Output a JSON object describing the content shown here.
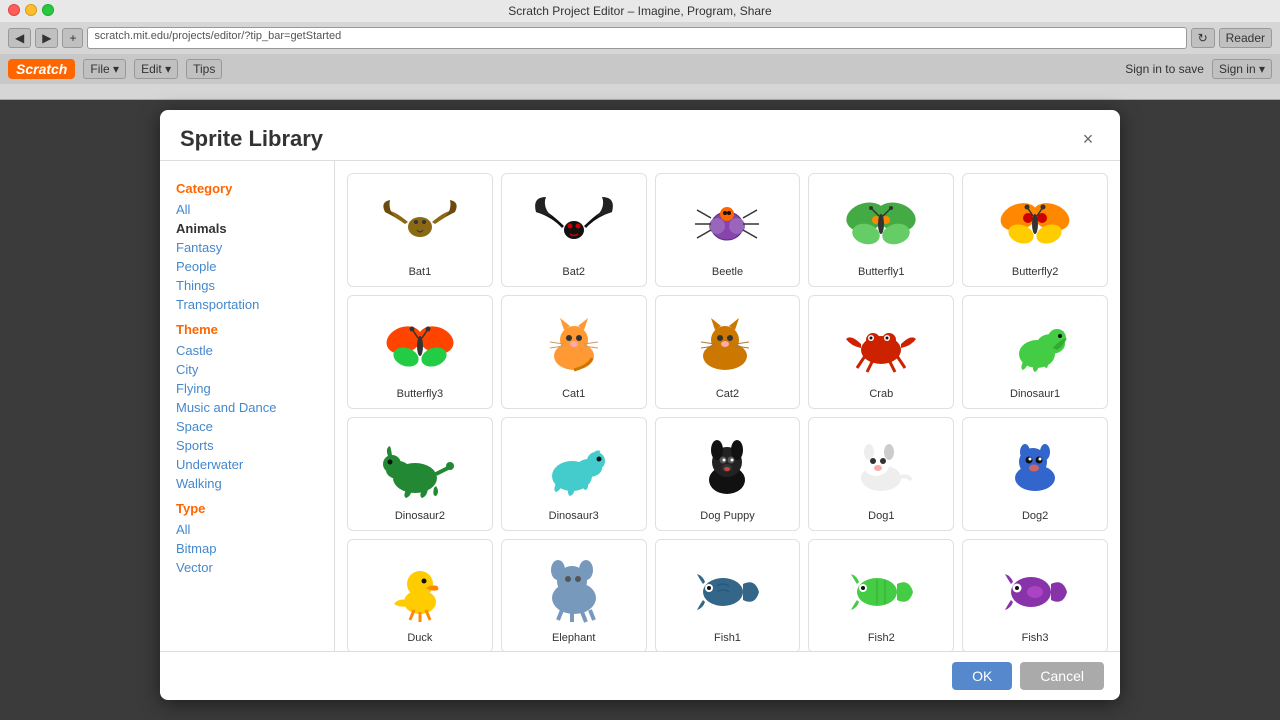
{
  "window": {
    "title": "Scratch Project Editor – Imagine, Program, Share",
    "url": "scratch.mit.edu/projects/editor/?tip_bar=getStarted"
  },
  "toolbar": {
    "sign_in_save": "Sign in to save",
    "sign_in": "Sign in ▾",
    "file_menu": "File ▾",
    "edit_menu": "Edit ▾",
    "tips_menu": "Tips"
  },
  "dialog": {
    "title": "Sprite Library",
    "close_label": "×"
  },
  "sidebar": {
    "category_label": "Category",
    "categories": [
      {
        "id": "all",
        "label": "All",
        "active": false
      },
      {
        "id": "animals",
        "label": "Animals",
        "active": true
      },
      {
        "id": "fantasy",
        "label": "Fantasy",
        "active": false
      },
      {
        "id": "people",
        "label": "People",
        "active": false
      },
      {
        "id": "things",
        "label": "Things",
        "active": false
      },
      {
        "id": "transportation",
        "label": "Transportation",
        "active": false
      }
    ],
    "theme_label": "Theme",
    "themes": [
      {
        "id": "castle",
        "label": "Castle"
      },
      {
        "id": "city",
        "label": "City"
      },
      {
        "id": "flying",
        "label": "Flying"
      },
      {
        "id": "music-and-dance",
        "label": "Music and Dance"
      },
      {
        "id": "space",
        "label": "Space"
      },
      {
        "id": "sports",
        "label": "Sports"
      },
      {
        "id": "underwater",
        "label": "Underwater"
      },
      {
        "id": "walking",
        "label": "Walking"
      }
    ],
    "type_label": "Type",
    "types": [
      {
        "id": "all-type",
        "label": "All"
      },
      {
        "id": "bitmap",
        "label": "Bitmap"
      },
      {
        "id": "vector",
        "label": "Vector"
      }
    ]
  },
  "sprites": [
    {
      "id": "bat1",
      "name": "Bat1",
      "color": "#8B6914",
      "emoji": "🦇"
    },
    {
      "id": "bat2",
      "name": "Bat2",
      "color": "#111111",
      "emoji": "🦇"
    },
    {
      "id": "beetle",
      "name": "Beetle",
      "color": "#8844aa",
      "emoji": "🐞"
    },
    {
      "id": "butterfly1",
      "name": "Butterfly1",
      "color": "#44aa44",
      "emoji": "🦋"
    },
    {
      "id": "butterfly2",
      "name": "Butterfly2",
      "color": "#ff8800",
      "emoji": "🦋"
    },
    {
      "id": "butterfly3",
      "name": "Butterfly3",
      "color": "#ff6600",
      "emoji": "🦋"
    },
    {
      "id": "cat1",
      "name": "Cat1",
      "color": "#ff9900",
      "emoji": "🐱"
    },
    {
      "id": "cat2",
      "name": "Cat2",
      "color": "#cc7700",
      "emoji": "🐱"
    },
    {
      "id": "crab",
      "name": "Crab",
      "color": "#cc2200",
      "emoji": "🦀"
    },
    {
      "id": "dinosaur1",
      "name": "Dinosaur1",
      "color": "#44cc44",
      "emoji": "🦕"
    },
    {
      "id": "dinosaur2",
      "name": "Dinosaur2",
      "color": "#228833",
      "emoji": "🦕"
    },
    {
      "id": "dinosaur3",
      "name": "Dinosaur3",
      "color": "#44cccc",
      "emoji": "🦕"
    },
    {
      "id": "dog-puppy",
      "name": "Dog Puppy",
      "color": "#222222",
      "emoji": "🐶"
    },
    {
      "id": "dog1",
      "name": "Dog1",
      "color": "#dddddd",
      "emoji": "🐕"
    },
    {
      "id": "dog2",
      "name": "Dog2",
      "color": "#3366cc",
      "emoji": "🐕"
    },
    {
      "id": "duck",
      "name": "Duck",
      "color": "#ffcc00",
      "emoji": "🦆"
    },
    {
      "id": "elephant",
      "name": "Elephant",
      "color": "#7799bb",
      "emoji": "🐘"
    },
    {
      "id": "fish1",
      "name": "Fish1",
      "color": "#336699",
      "emoji": "🐟"
    },
    {
      "id": "fish2",
      "name": "Fish2",
      "color": "#44cc44",
      "emoji": "🐠"
    },
    {
      "id": "fish3",
      "name": "Fish3",
      "color": "#8833aa",
      "emoji": "🐡"
    }
  ],
  "footer": {
    "ok_label": "OK",
    "cancel_label": "Cancel"
  }
}
